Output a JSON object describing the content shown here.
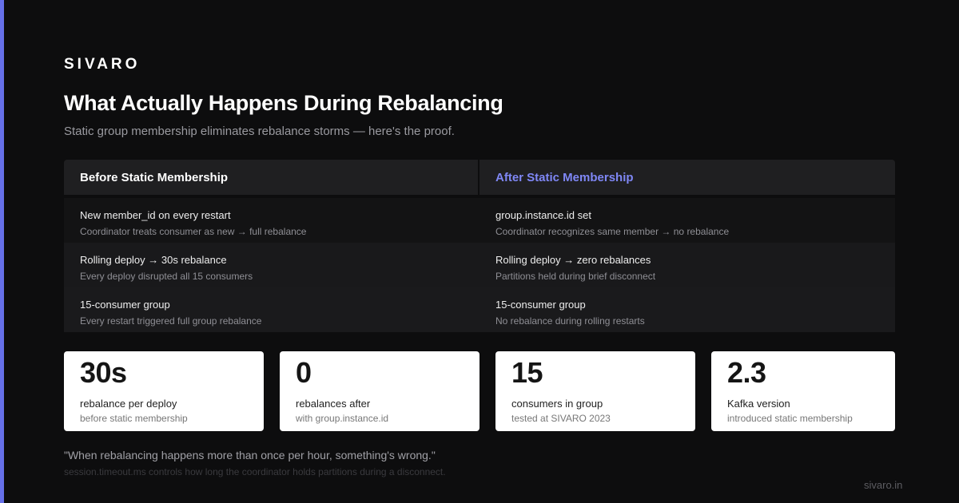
{
  "brand": "SIVARO",
  "title": "What Actually Happens During Rebalancing",
  "subtitle": "Static group membership eliminates rebalance storms — here's the proof.",
  "comparison": {
    "before_header": "Before Static Membership",
    "after_header": "After Static Membership",
    "rows": [
      {
        "before_main": "New member_id on every restart",
        "before_sub": "Coordinator treats consumer as new → full rebalance",
        "after_main": "group.instance.id set",
        "after_sub": "Coordinator recognizes same member → no rebalance"
      },
      {
        "before_main": "Rolling deploy → 30s rebalance",
        "before_sub": "Every deploy disrupted all 15 consumers",
        "after_main": "Rolling deploy → zero rebalances",
        "after_sub": "Partitions held during brief disconnect"
      },
      {
        "before_main": "15-consumer group",
        "before_sub": "Every restart triggered full group rebalance",
        "after_main": "15-consumer group",
        "after_sub": "No rebalance during rolling restarts"
      }
    ]
  },
  "stats": [
    {
      "value": "30s",
      "label": "rebalance per deploy",
      "note": "before static membership"
    },
    {
      "value": "0",
      "label": "rebalances after",
      "note": "with group.instance.id"
    },
    {
      "value": "15",
      "label": "consumers in group",
      "note": "tested at SIVARO 2023"
    },
    {
      "value": "2.3",
      "label": "Kafka version",
      "note": "introduced static membership"
    }
  ],
  "quote": "\"When rebalancing happens more than once per hour, something's wrong.\"",
  "footnote": "session.timeout.ms controls how long the coordinator holds partitions during a disconnect.",
  "site": "sivaro.in",
  "colors": {
    "background": "#0d0d0e",
    "accent": "#6670e8",
    "after_header": "#7f87f5",
    "card": "#ffffff"
  }
}
